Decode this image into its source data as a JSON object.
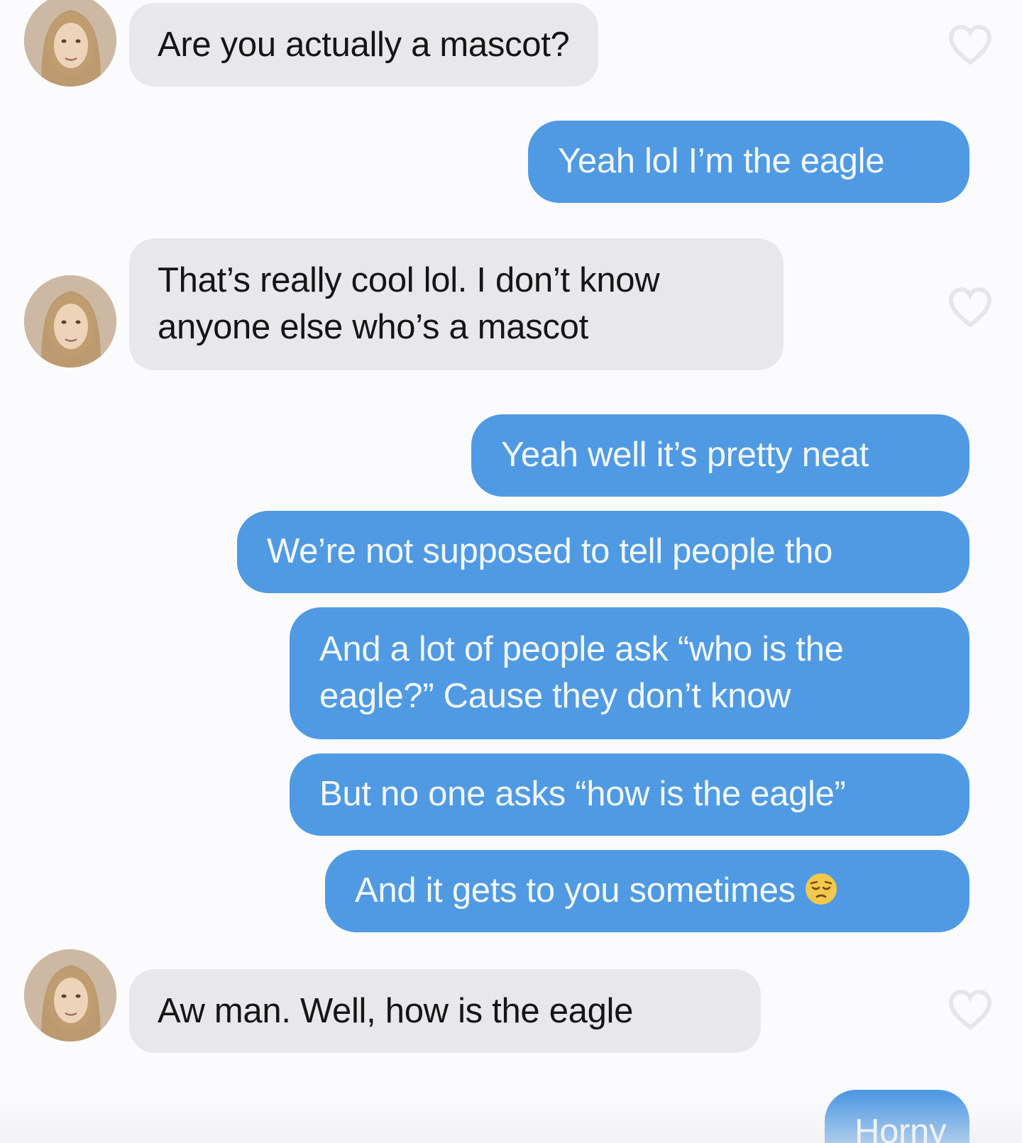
{
  "messages": [
    {
      "from": "them",
      "text": "Are you actually a mascot?"
    },
    {
      "from": "me",
      "text": "Yeah lol I’m the eagle"
    },
    {
      "from": "them",
      "text": "That’s really cool lol. I don’t know anyone else who’s a mascot",
      "lines": [
        "That’s really cool lol. I don’t know",
        "anyone else who’s a mascot"
      ]
    },
    {
      "from": "me",
      "text": "Yeah well it’s pretty neat"
    },
    {
      "from": "me",
      "text": "We’re not supposed to tell people tho"
    },
    {
      "from": "me",
      "text": "And a lot of people ask “who is the eagle?” Cause they don’t know",
      "lines": [
        "And a lot of people ask “who is the",
        "eagle?” Cause they don’t know"
      ]
    },
    {
      "from": "me",
      "text": "But no one asks “how is the eagle”"
    },
    {
      "from": "me",
      "text": "And it gets to you sometimes",
      "emoji": "pensive-face-emoji"
    },
    {
      "from": "them",
      "text": "Aw man. Well, how is the eagle"
    },
    {
      "from": "me",
      "text": "Horny"
    }
  ],
  "icons": {
    "avatar": "profile-photo",
    "reaction": "heart-outline-icon"
  },
  "colors": {
    "incoming_bubble": "#e8e8ec",
    "outgoing_bubble": "#4f9ae3",
    "background": "#fbfbfd"
  }
}
